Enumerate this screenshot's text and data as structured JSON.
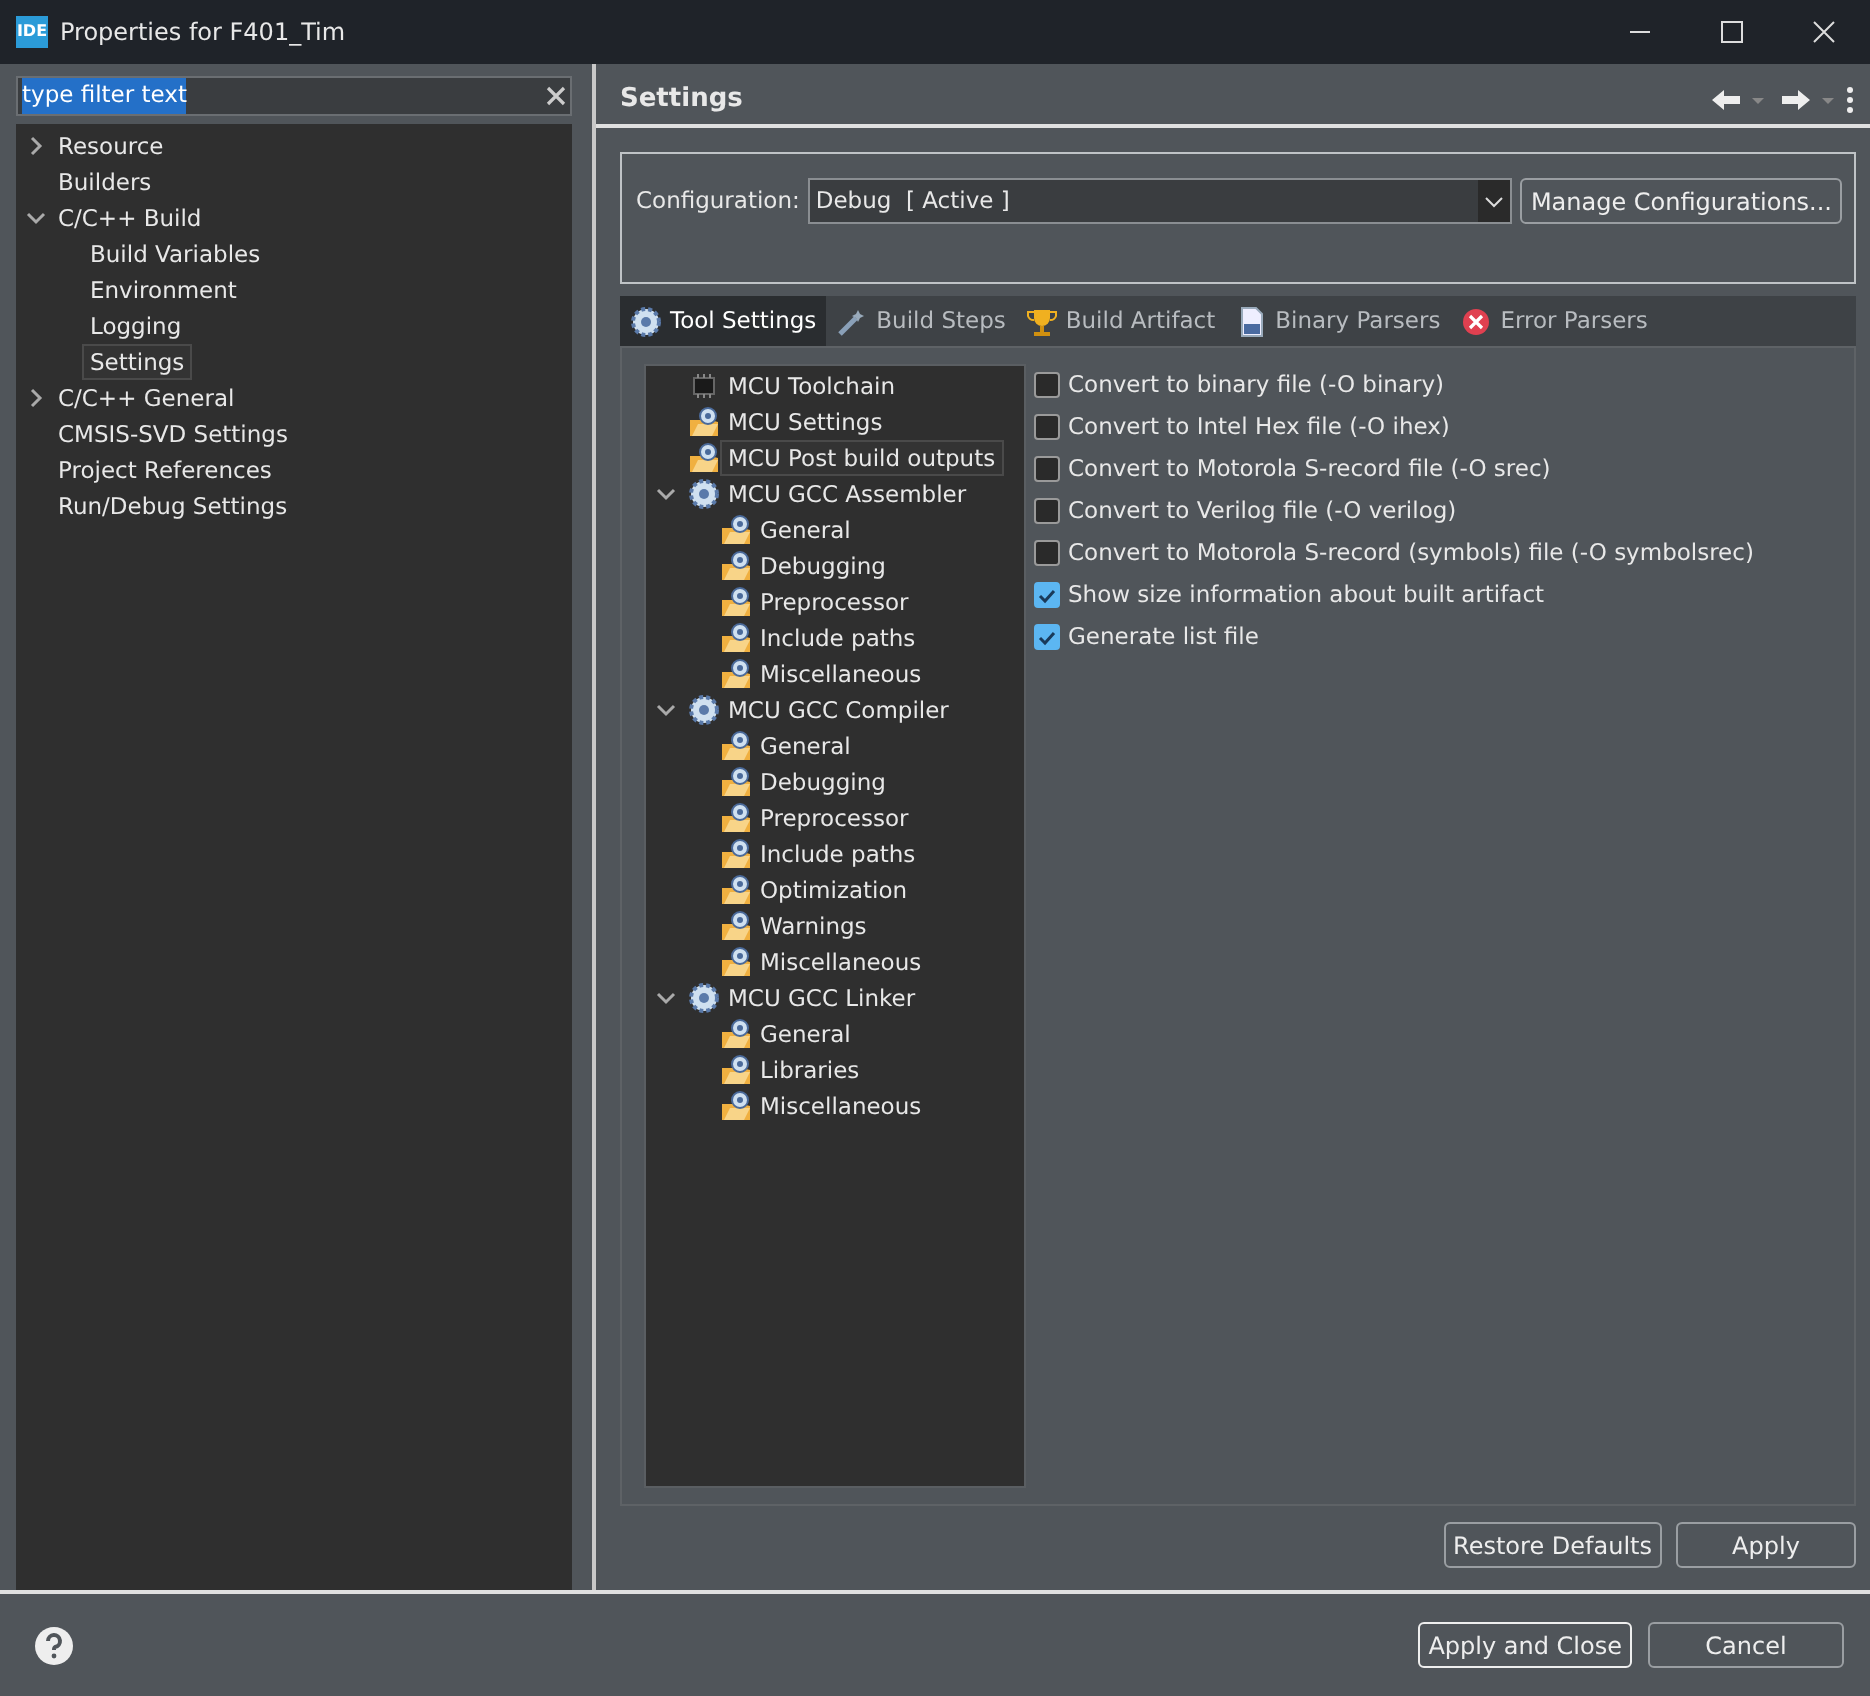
{
  "window": {
    "title": "Properties for F401_Tim",
    "app_badge": "IDE"
  },
  "filter": {
    "value": "type filter text"
  },
  "nav": [
    {
      "label": "Resource",
      "expanded": false,
      "selected": false
    },
    {
      "label": "Builders",
      "selected": false
    },
    {
      "label": "C/C++ Build",
      "expanded": true,
      "selected": false,
      "children": [
        {
          "label": "Build Variables",
          "selected": false
        },
        {
          "label": "Environment",
          "selected": false
        },
        {
          "label": "Logging",
          "selected": false
        },
        {
          "label": "Settings",
          "selected": true
        }
      ]
    },
    {
      "label": "C/C++ General",
      "expanded": false,
      "selected": false
    },
    {
      "label": "CMSIS-SVD Settings",
      "selected": false
    },
    {
      "label": "Project References",
      "selected": false
    },
    {
      "label": "Run/Debug Settings",
      "selected": false
    }
  ],
  "page": {
    "title": "Settings"
  },
  "configuration": {
    "label": "Configuration:",
    "value": "Debug  [ Active ]",
    "manage_button": "Manage Configurations..."
  },
  "tabs": [
    {
      "label": "Tool Settings",
      "kind": "gear",
      "selected": true
    },
    {
      "label": "Build Steps",
      "kind": "wand",
      "selected": false
    },
    {
      "label": "Build Artifact",
      "kind": "trophy",
      "selected": false
    },
    {
      "label": "Binary Parsers",
      "kind": "binary",
      "selected": false
    },
    {
      "label": "Error Parsers",
      "kind": "error",
      "selected": false
    }
  ],
  "tool_tree": [
    {
      "label": "MCU Toolchain",
      "kind": "chip",
      "selected": false
    },
    {
      "label": "MCU Settings",
      "kind": "folder",
      "selected": false
    },
    {
      "label": "MCU Post build outputs",
      "kind": "folder",
      "selected": true
    },
    {
      "label": "MCU GCC Assembler",
      "kind": "gear",
      "expanded": true,
      "selected": false,
      "children": [
        {
          "label": "General",
          "kind": "folder",
          "selected": false
        },
        {
          "label": "Debugging",
          "kind": "folder",
          "selected": false
        },
        {
          "label": "Preprocessor",
          "kind": "folder",
          "selected": false
        },
        {
          "label": "Include paths",
          "kind": "folder",
          "selected": false
        },
        {
          "label": "Miscellaneous",
          "kind": "folder",
          "selected": false
        }
      ]
    },
    {
      "label": "MCU GCC Compiler",
      "kind": "gear",
      "expanded": true,
      "selected": false,
      "children": [
        {
          "label": "General",
          "kind": "folder",
          "selected": false
        },
        {
          "label": "Debugging",
          "kind": "folder",
          "selected": false
        },
        {
          "label": "Preprocessor",
          "kind": "folder",
          "selected": false
        },
        {
          "label": "Include paths",
          "kind": "folder",
          "selected": false
        },
        {
          "label": "Optimization",
          "kind": "folder",
          "selected": false
        },
        {
          "label": "Warnings",
          "kind": "folder",
          "selected": false
        },
        {
          "label": "Miscellaneous",
          "kind": "folder",
          "selected": false
        }
      ]
    },
    {
      "label": "MCU GCC Linker",
      "kind": "gear",
      "expanded": true,
      "selected": false,
      "children": [
        {
          "label": "General",
          "kind": "folder",
          "selected": false
        },
        {
          "label": "Libraries",
          "kind": "folder",
          "selected": false
        },
        {
          "label": "Miscellaneous",
          "kind": "folder",
          "selected": false
        }
      ]
    }
  ],
  "options": [
    {
      "label": "Convert to binary file (-O binary)",
      "checked": false
    },
    {
      "label": "Convert to Intel Hex file (-O ihex)",
      "checked": false
    },
    {
      "label": "Convert to Motorola S-record file (-O srec)",
      "checked": false
    },
    {
      "label": "Convert to Verilog file (-O verilog)",
      "checked": false
    },
    {
      "label": "Convert to Motorola S-record (symbols) file (-O symbolsrec)",
      "checked": false
    },
    {
      "label": "Show size information about built artifact",
      "checked": true
    },
    {
      "label": "Generate list file",
      "checked": true
    }
  ],
  "page_buttons": [
    "Restore Defaults",
    "Apply"
  ],
  "dialog_buttons": [
    "Apply and Close",
    "Cancel"
  ]
}
